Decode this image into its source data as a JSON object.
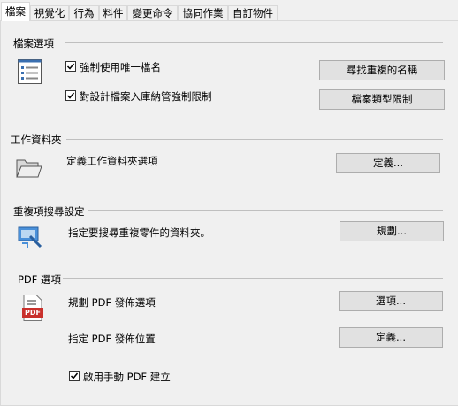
{
  "tabs": [
    "檔案",
    "視覺化",
    "行為",
    "料件",
    "變更命令",
    "協同作業",
    "自訂物件"
  ],
  "active_tab": "檔案",
  "file_options": {
    "header": "檔案選項",
    "enforce_unique_label": "強制使用唯一檔名",
    "enforce_unique_checked": true,
    "find_duplicates_button": "尋找重複的名稱",
    "design_check_in_label": "對設計檔案入庫納管強制限制",
    "design_check_in_checked": true,
    "file_type_button": "檔案類型限制"
  },
  "working_folder": {
    "header": "工作資料夾",
    "define_label": "定義工作資料夾選項",
    "define_button": "定義..."
  },
  "duplicate_search": {
    "header": "重複項搜尋設定",
    "specify_label": "指定要搜尋重複零件的資料夾。",
    "plan_button": "規劃..."
  },
  "pdf": {
    "header": "PDF 選項",
    "icon_text": "PDF",
    "plan_label": "規劃 PDF 發佈選項",
    "options_button": "選項...",
    "location_label": "指定 PDF 發佈位置",
    "location_button": "定義...",
    "manual_label": "啟用手動 PDF 建立",
    "manual_checked": true
  }
}
